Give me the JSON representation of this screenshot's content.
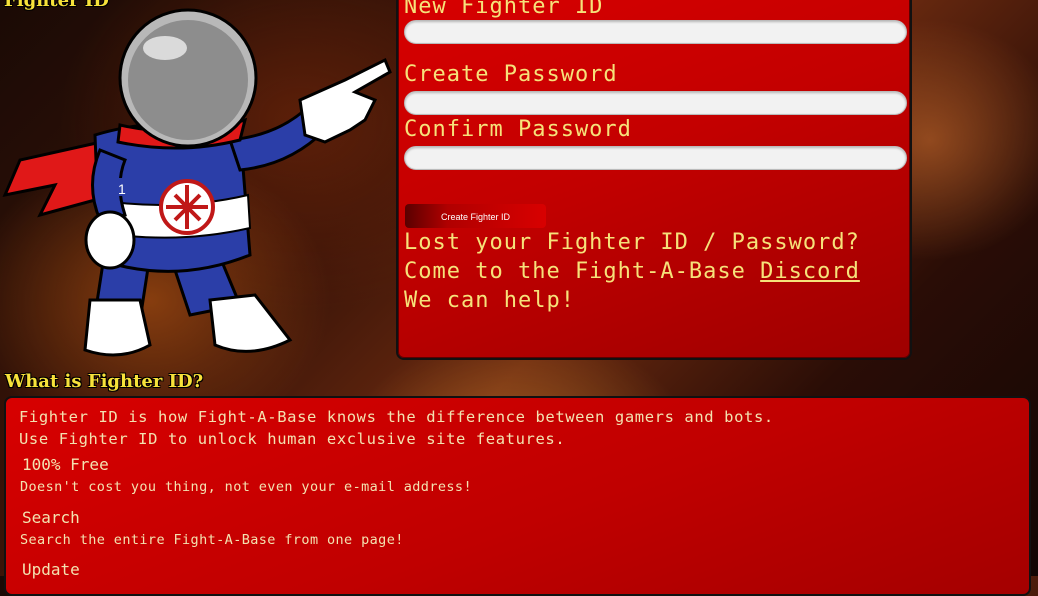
{
  "page": {
    "title": "Fighter ID"
  },
  "form": {
    "new_id_label": "New Fighter ID",
    "new_id_value": "",
    "create_password_label": "Create Password",
    "create_password_value": "",
    "confirm_password_label": "Confirm Password",
    "confirm_password_value": "",
    "submit_label": "Create Fighter ID"
  },
  "help": {
    "line1": "Lost your Fighter ID / Password?",
    "line2_prefix": "Come to the Fight-A-Base ",
    "line2_link": "Discord",
    "line3": "We can help!"
  },
  "info": {
    "heading": "What is Fighter ID?",
    "intro1": "Fighter ID is how Fight-A-Base knows the difference between gamers and bots.",
    "intro2": "Use Fighter ID to unlock human exclusive site features.",
    "features": [
      {
        "title": "100% Free",
        "desc": "Doesn't cost you thing, not even your e-mail address!"
      },
      {
        "title": "Search",
        "desc": "Search the entire Fight-A-Base from one page!"
      },
      {
        "title": "Update",
        "desc": ""
      }
    ]
  },
  "mascot": {
    "badge_number": "1"
  },
  "colors": {
    "accent_yellow": "#f7e23a",
    "panel_red": "#c30000"
  }
}
